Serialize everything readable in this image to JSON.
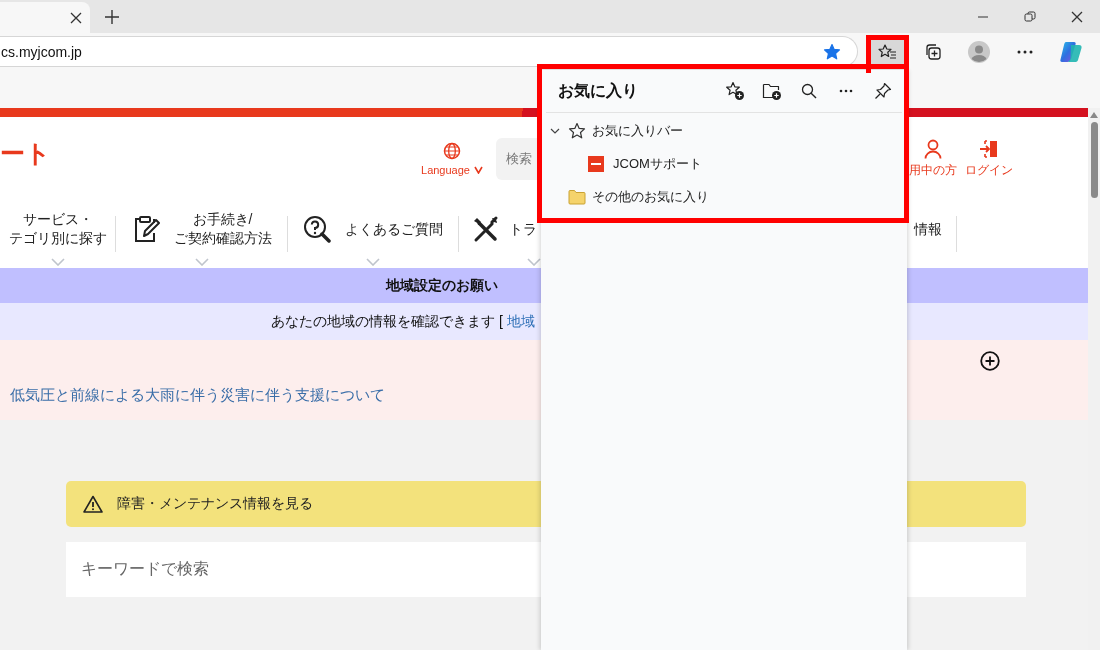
{
  "address_bar": {
    "url": "cs.myjcom.jp"
  },
  "toolbar": [
    {
      "kind": "favorites",
      "selected": true
    },
    {
      "kind": "collections",
      "selected": false
    },
    {
      "kind": "profile",
      "selected": false
    },
    {
      "kind": "more",
      "selected": false
    },
    {
      "kind": "copilot",
      "selected": false
    }
  ],
  "page": {
    "logo_text": "ート",
    "language": "Language",
    "search_placeholder": "検索",
    "header_links": [
      {
        "kind": "person",
        "label": "用中の方"
      },
      {
        "kind": "login",
        "label": "ログイン"
      }
    ],
    "nav": [
      {
        "kind": "plain",
        "lines": [
          "サービス・",
          "テゴリ別に探す"
        ],
        "has_menu": true
      },
      {
        "kind": "clipboard",
        "lines": [
          "お手続き/",
          "ご契約確認方法"
        ],
        "has_menu": true
      },
      {
        "kind": "question",
        "lines": [
          "よくあるご質問"
        ],
        "has_menu": true
      },
      {
        "kind": "tools",
        "lines": [
          "トラ"
        ],
        "has_menu": true
      },
      {
        "kind": "plain",
        "lines": [
          "情報"
        ],
        "has_menu": false
      }
    ],
    "notice_title": "地域設定のお願い",
    "notice_text": "あなたの地域の情報を確認できます [",
    "notice_link": "地域",
    "alert_link": "低気圧と前線による大雨に伴う災害に伴う支援について",
    "maintenance": "障害・メンテナンス情報を見る",
    "keyword_placeholder": "キーワードで検索"
  },
  "favorites_panel": {
    "title": "お気に入り",
    "items": [
      {
        "kind": "bar",
        "label": "お気に入りバー",
        "expanded": true,
        "children": [
          {
            "kind": "site",
            "label": "JCOMサポート"
          }
        ]
      },
      {
        "kind": "folder",
        "label": "その他のお気に入り"
      }
    ]
  }
}
